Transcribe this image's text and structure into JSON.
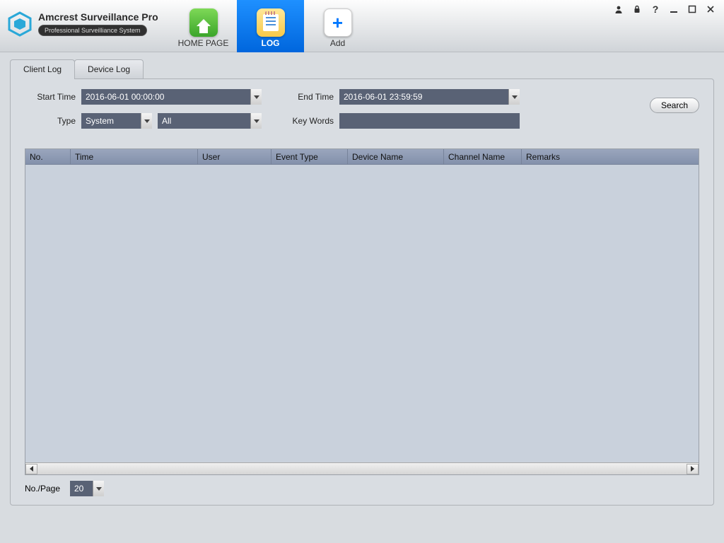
{
  "brand": {
    "title": "Amcrest Surveillance Pro",
    "subtitle": "Professional Surveilliance System"
  },
  "nav": {
    "home": "HOME PAGE",
    "log": "LOG",
    "add": "Add"
  },
  "subtabs": {
    "client": "Client Log",
    "device": "Device Log"
  },
  "filters": {
    "start_label": "Start Time",
    "start_value": "2016-06-01 00:00:00",
    "end_label": "End Time",
    "end_value": "2016-06-01 23:59:59",
    "type_label": "Type",
    "type_value": "System",
    "subtype_value": "All",
    "keywords_label": "Key Words",
    "keywords_value": ""
  },
  "search_label": "Search",
  "columns": {
    "no": "No.",
    "time": "Time",
    "user": "User",
    "event": "Event Type",
    "device": "Device Name",
    "channel": "Channel Name",
    "remarks": "Remarks"
  },
  "pager": {
    "label": "No./Page",
    "value": "20"
  }
}
